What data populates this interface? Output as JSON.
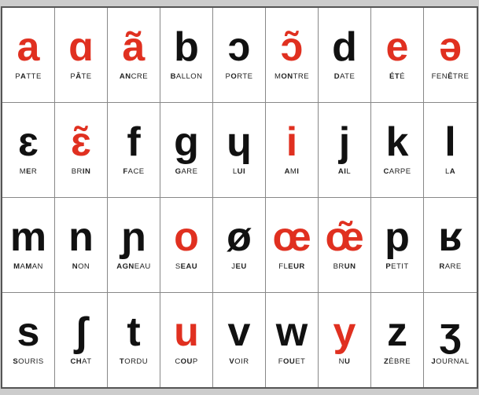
{
  "rows": [
    {
      "cells": [
        {
          "symbol": "a",
          "red": true,
          "label": "P<b>A</b>TTE"
        },
        {
          "symbol": "ɑ",
          "red": true,
          "label": "P<b>Â</b>TE"
        },
        {
          "symbol": "ã",
          "red": true,
          "label": "<b>AN</b>CRE"
        },
        {
          "symbol": "b",
          "red": false,
          "label": "<b>B</b>ALLON"
        },
        {
          "symbol": "ɔ",
          "red": false,
          "label": "P<b>O</b>RTE"
        },
        {
          "symbol": "ɔ̃",
          "red": true,
          "label": "M<b>ON</b>TRE"
        },
        {
          "symbol": "d",
          "red": false,
          "label": "<b>D</b>ATE"
        },
        {
          "symbol": "e",
          "red": true,
          "label": "<b>ÉT</b>É"
        },
        {
          "symbol": "ə",
          "red": true,
          "label": "FEN<b>Ê</b>TRE"
        }
      ]
    },
    {
      "cells": [
        {
          "symbol": "ɛ",
          "red": false,
          "label": "M<b>E</b>R"
        },
        {
          "symbol": "ɛ̃",
          "red": true,
          "label": "BR<b>IN</b>"
        },
        {
          "symbol": "f",
          "red": false,
          "label": "<b>F</b>ACE"
        },
        {
          "symbol": "g",
          "red": false,
          "label": "<b>G</b>ARE"
        },
        {
          "symbol": "ɥ",
          "red": false,
          "label": "L<b>UI</b>"
        },
        {
          "symbol": "i",
          "red": true,
          "label": "<b>A</b>M<b>I</b>"
        },
        {
          "symbol": "j",
          "red": false,
          "label": "<b>AI</b>L"
        },
        {
          "symbol": "k",
          "red": false,
          "label": "<b>C</b>ARPE"
        },
        {
          "symbol": "l",
          "red": false,
          "label": "L<b>A</b>"
        }
      ]
    },
    {
      "cells": [
        {
          "symbol": "m",
          "red": false,
          "label": "<b>M</b>A<b>M</b>AN"
        },
        {
          "symbol": "n",
          "red": false,
          "label": "<b>N</b>ON"
        },
        {
          "symbol": "ɲ",
          "red": false,
          "label": "<b>AGN</b>EAU"
        },
        {
          "symbol": "o",
          "red": true,
          "label": "S<b>EAU</b>"
        },
        {
          "symbol": "ø",
          "red": false,
          "label": "J<b>EU</b>"
        },
        {
          "symbol": "œ",
          "red": true,
          "label": "FL<b>EUR</b>"
        },
        {
          "symbol": "œ̃",
          "red": true,
          "label": "BR<b>UN</b>"
        },
        {
          "symbol": "p",
          "red": false,
          "label": "<b>P</b>ETIT"
        },
        {
          "symbol": "ʁ",
          "red": false,
          "label": "<b>R</b>ARE"
        }
      ]
    },
    {
      "cells": [
        {
          "symbol": "s",
          "red": false,
          "label": "<b>S</b>OURIS"
        },
        {
          "symbol": "ʃ",
          "red": false,
          "label": "<b>CH</b>AT"
        },
        {
          "symbol": "t",
          "red": false,
          "label": "<b>T</b>ORDU"
        },
        {
          "symbol": "u",
          "red": true,
          "label": "C<b>OU</b>P"
        },
        {
          "symbol": "v",
          "red": false,
          "label": "<b>V</b>OIR"
        },
        {
          "symbol": "w",
          "red": false,
          "label": "F<b>OU</b>ET"
        },
        {
          "symbol": "y",
          "red": true,
          "label": "N<b>U</b>"
        },
        {
          "symbol": "z",
          "red": false,
          "label": "<b>Z</b>ÈBRE"
        },
        {
          "symbol": "ʒ",
          "red": false,
          "label": "<b>J</b>OURNAL"
        }
      ]
    }
  ]
}
